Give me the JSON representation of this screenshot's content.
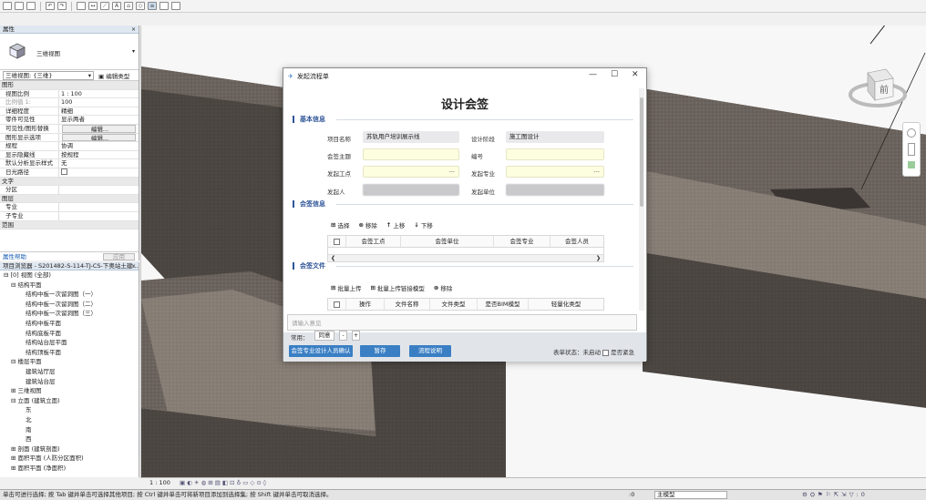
{
  "toolbar": {
    "icons": [
      "open-icon",
      "save-icon",
      "sync-icon",
      "undo-icon",
      "redo-icon",
      "print-icon",
      "measure-icon",
      "dimension-icon",
      "text-icon",
      "3d-view-icon",
      "section-icon",
      "thin-lines-icon",
      "close-hidden-icon",
      "switch-windows-icon"
    ],
    "text_icon_glyph": "A"
  },
  "properties": {
    "title": "属性",
    "close": "×",
    "type_name": "三维视图",
    "selector": "三维视图: {三维}",
    "edit_type": "编辑类型",
    "rows": [
      {
        "k": "图形",
        "section": true
      },
      {
        "k": "视图比例",
        "v": "1 : 100"
      },
      {
        "k": "比例值 1:",
        "v": "100",
        "grey": true
      },
      {
        "k": "详细程度",
        "v": "精细"
      },
      {
        "k": "零件可见性",
        "v": "显示两者"
      },
      {
        "k": "可见性/图形替换",
        "v": "编辑...",
        "btn": true
      },
      {
        "k": "图形显示选项",
        "v": "编辑...",
        "btn": true
      },
      {
        "k": "规程",
        "v": "协调"
      },
      {
        "k": "显示隐藏线",
        "v": "按规程"
      },
      {
        "k": "默认分析显示样式",
        "v": "无"
      },
      {
        "k": "日光路径",
        "v": "",
        "check": true
      },
      {
        "k": "文字",
        "section": true
      },
      {
        "k": "分区",
        "v": ""
      },
      {
        "k": "图层",
        "section": true
      },
      {
        "k": "专业",
        "v": ""
      },
      {
        "k": "子专业",
        "v": ""
      },
      {
        "k": "范围",
        "section": true
      }
    ],
    "help_link": "属性帮助",
    "apply": "应用"
  },
  "browser": {
    "title": "项目浏览器 - S201482-S-114-TJ-CS-下奥站土建...",
    "close": "×",
    "items": [
      {
        "t": "⊟ [0] 视图 (全部)",
        "i": 0
      },
      {
        "t": "⊟ 结构平面",
        "i": 1
      },
      {
        "t": "结构中板一次留洞图（一）",
        "i": 3
      },
      {
        "t": "结构中板一次留洞图（二）",
        "i": 3
      },
      {
        "t": "结构中板一次留洞图（三）",
        "i": 3
      },
      {
        "t": "结构中板平面",
        "i": 3
      },
      {
        "t": "结构底板平面",
        "i": 3
      },
      {
        "t": "结构站台层平面",
        "i": 3
      },
      {
        "t": "结构顶板平面",
        "i": 3
      },
      {
        "t": "⊟ 楼层平面",
        "i": 1
      },
      {
        "t": "建筑站厅层",
        "i": 3
      },
      {
        "t": "建筑站台层",
        "i": 3
      },
      {
        "t": "⊞ 三维视图",
        "i": 1
      },
      {
        "t": "⊟ 立面 (建筑立面)",
        "i": 1
      },
      {
        "t": "东",
        "i": 3
      },
      {
        "t": "北",
        "i": 3
      },
      {
        "t": "南",
        "i": 3
      },
      {
        "t": "西",
        "i": 3
      },
      {
        "t": "⊞ 剖面 (建筑剖面)",
        "i": 1
      },
      {
        "t": "⊞ 面积平面 (人防分区面积)",
        "i": 1
      },
      {
        "t": "⊞ 面积平面 (净面积)",
        "i": 1
      }
    ]
  },
  "dialog": {
    "window_title": "发起流程单",
    "min": "—",
    "max": "☐",
    "close": "✕",
    "heading": "设计会签",
    "sec_basic": "基本信息",
    "project_label": "项目名称",
    "project_value": "苏轨用户培训展示线",
    "stage_label": "设计阶段",
    "stage_value": "施工图设计",
    "topic_label": "会签主题",
    "number_label": "编号",
    "point_label": "发起工点",
    "major_label": "发起专业",
    "person_label": "发起人",
    "unit_label": "发起单位",
    "dots": "···",
    "sec_sign": "会签信息",
    "sign_toolbar": [
      "选择",
      "移除",
      "上移",
      "下移"
    ],
    "sign_cols": [
      "",
      "会签工点",
      "会签单位",
      "会签专业",
      "会签人员"
    ],
    "sec_files": "会签文件",
    "file_toolbar": [
      "批量上传",
      "批量上传链接模型",
      "移除"
    ],
    "file_cols": [
      "",
      "操作",
      "文件名称",
      "文件类型",
      "是否BIM模型",
      "轻量化类型"
    ],
    "opinion_placeholder": "请输入意见",
    "common_label": "常用：",
    "common_value": "同意",
    "minus": "-",
    "plus": "+",
    "btn_confirm": "会签专业设计人员确认",
    "btn_save": "暂存",
    "btn_explain": "流程说明",
    "status_text": "表单状态：未启动",
    "urgent": "是否紧急"
  },
  "viewbar": {
    "scale": "1 : 100"
  },
  "viewcube": {
    "face": "前"
  },
  "status": {
    "text": "单击可进行选择; 按 Tab 键并单击可选择其他项目; 按 Ctrl 键并单击可将新项目添加到选择集; 按 Shift 键并单击可取消选择。",
    "zero": ":0",
    "model": "主模型"
  }
}
